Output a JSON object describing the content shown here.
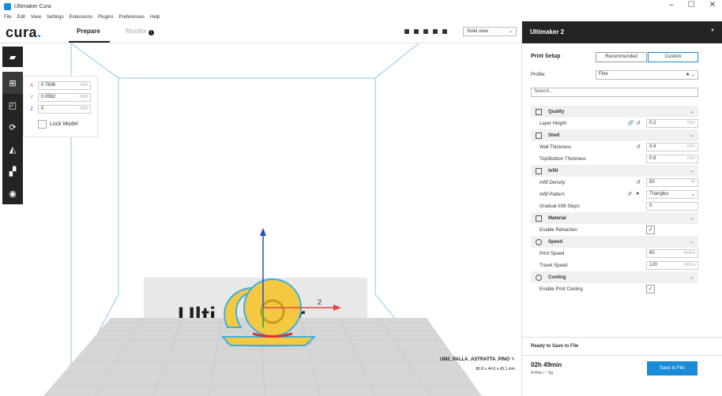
{
  "window": {
    "title": "Ultimaker Cura",
    "controls": [
      "–",
      "☐",
      "✕"
    ]
  },
  "menu": [
    "File",
    "Edit",
    "View",
    "Settings",
    "Extensions",
    "Plugins",
    "Preferences",
    "Help"
  ],
  "header": {
    "logo_text": "cura",
    "logo_dot": ".",
    "tabs": [
      {
        "label": "Prepare",
        "active": true
      },
      {
        "label": "Monitor",
        "active": false
      }
    ],
    "view_mode": "Solid view"
  },
  "toolbar": {
    "icons": [
      "folder-open-icon",
      "move-icon",
      "scale-icon",
      "rotate-icon",
      "mirror-icon",
      "per-model-settings-icon",
      "support-blocker-icon"
    ]
  },
  "move_panel": {
    "x": {
      "label": "X",
      "value": "0.7836",
      "unit": "mm"
    },
    "y": {
      "label": "Y",
      "value": "0.0562",
      "unit": "mm"
    },
    "z": {
      "label": "Z",
      "value": "0",
      "unit": "mm"
    },
    "lock_label": "Lock Model"
  },
  "viewport": {
    "job_name": "UM2_PALLA_ASTRATTA_PINO",
    "dimensions": "80.8 x 44.6 x 45.1 mm",
    "axis_label": "2"
  },
  "panel": {
    "printer": "Ultimaker 2",
    "print_setup": "Print Setup",
    "mode_recommended": "Recommended",
    "mode_custom": "Custom",
    "profile_label": "Profile:",
    "profile_value": "Fine",
    "search_placeholder": "Search...",
    "categories": [
      {
        "name": "Quality",
        "rows": [
          {
            "label": "Layer Height",
            "value": "0.2",
            "unit": "mm",
            "italic": true,
            "reset": true,
            "link": true
          }
        ]
      },
      {
        "name": "Shell",
        "rows": [
          {
            "label": "Wall Thickness",
            "value": "0.4",
            "unit": "mm",
            "italic": false,
            "reset": true
          },
          {
            "label": "Top/Bottom Thickness",
            "value": "0.8",
            "unit": "mm",
            "italic": false,
            "reset": false
          }
        ]
      },
      {
        "name": "Infill",
        "rows": [
          {
            "label": "Infill Density",
            "value": "50",
            "unit": "%",
            "italic": true,
            "reset": true
          },
          {
            "label": "Infill Pattern",
            "value": "Triangles",
            "unit": "",
            "italic": true,
            "reset": true,
            "dropdown": true
          },
          {
            "label": "Gradual Infill Steps",
            "value": "0",
            "unit": "",
            "italic": false,
            "reset": false
          }
        ]
      },
      {
        "name": "Material",
        "rows": [
          {
            "label": "Enable Retraction",
            "check": true
          }
        ]
      },
      {
        "name": "Speed",
        "rows": [
          {
            "label": "Print Speed",
            "value": "60",
            "unit": "mm/s",
            "italic": false,
            "reset": false
          },
          {
            "label": "Travel Speed",
            "value": "120",
            "unit": "mm/s",
            "italic": false,
            "reset": false
          }
        ]
      },
      {
        "name": "Cooling",
        "rows": [
          {
            "label": "Enable Print Cooling",
            "check": true
          }
        ]
      }
    ],
    "ready_text": "Ready to Save to File",
    "print_time": "02h 49min",
    "material_usage": "4.65m / ~ 0g",
    "save_button": "Save to File"
  },
  "colors": {
    "accent": "#1a8cd8",
    "toolbar": "#242424",
    "model_yellow": "#f5c842",
    "model_outline": "#3ab0e0"
  }
}
